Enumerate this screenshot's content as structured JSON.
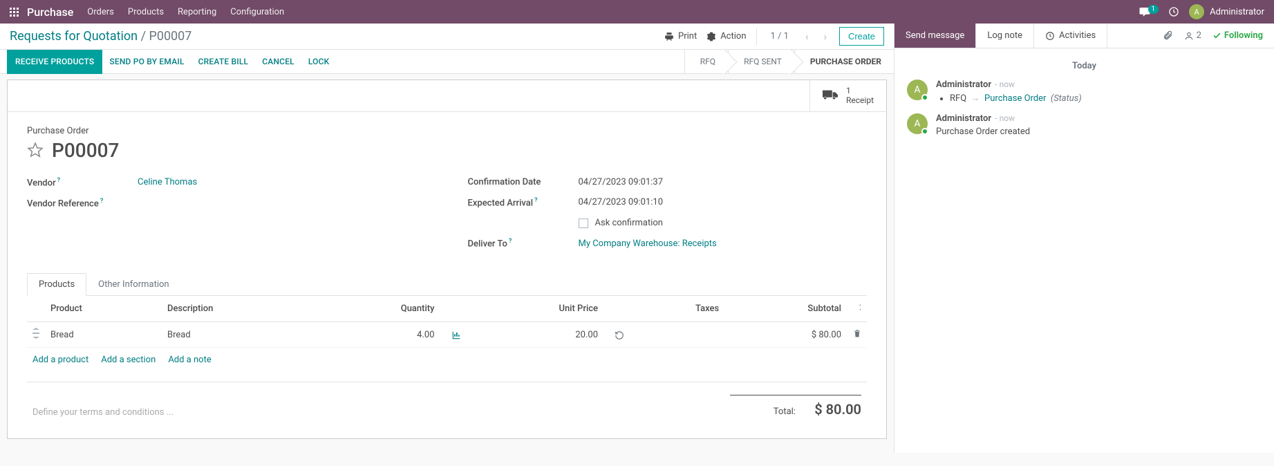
{
  "topnav": {
    "brand": "Purchase",
    "links": [
      "Orders",
      "Products",
      "Reporting",
      "Configuration"
    ],
    "chat_count": "1",
    "user_initial": "A",
    "user_name": "Administrator"
  },
  "breadcrumb": {
    "parent": "Requests for Quotation",
    "current": "P00007"
  },
  "controlbar": {
    "print": "Print",
    "action": "Action",
    "pager": "1 / 1",
    "create": "Create"
  },
  "statusbar": {
    "buttons": [
      "RECEIVE PRODUCTS",
      "SEND PO BY EMAIL",
      "CREATE BILL",
      "CANCEL",
      "LOCK"
    ],
    "stages": [
      "RFQ",
      "RFQ SENT",
      "PURCHASE ORDER"
    ]
  },
  "stat": {
    "receipt_count": "1",
    "receipt_label": "Receipt"
  },
  "form": {
    "title_label": "Purchase Order",
    "po_number": "P00007",
    "vendor_label": "Vendor",
    "vendor": "Celine Thomas",
    "vendor_ref_label": "Vendor Reference",
    "confirm_date_label": "Confirmation Date",
    "confirm_date": "04/27/2023 09:01:37",
    "expected_label": "Expected Arrival",
    "expected": "04/27/2023 09:01:10",
    "ask_conf": "Ask confirmation",
    "deliver_label": "Deliver To",
    "deliver_to": "My Company Warehouse: Receipts"
  },
  "tabs": [
    "Products",
    "Other Information"
  ],
  "table": {
    "cols": [
      "Product",
      "Description",
      "Quantity",
      "Unit Price",
      "Taxes",
      "Subtotal"
    ],
    "rows": [
      {
        "product": "Bread",
        "description": "Bread",
        "qty": "4.00",
        "price": "20.00",
        "taxes": "",
        "subtotal": "$ 80.00"
      }
    ],
    "add_product": "Add a product",
    "add_section": "Add a section",
    "add_note": "Add a note"
  },
  "terms_placeholder": "Define your terms and conditions ...",
  "total": {
    "label": "Total:",
    "value": "$  80.00"
  },
  "chatter": {
    "send": "Send message",
    "log": "Log note",
    "activities": "Activities",
    "follower_count": "2",
    "following": "Following",
    "today": "Today",
    "messages": [
      {
        "author": "Administrator",
        "time": "now",
        "type": "status",
        "field": "RFQ",
        "arrow": "→",
        "new_val": "Purchase Order",
        "suffix": "(Status)"
      },
      {
        "author": "Administrator",
        "time": "now",
        "type": "text",
        "body": "Purchase Order created"
      }
    ]
  }
}
